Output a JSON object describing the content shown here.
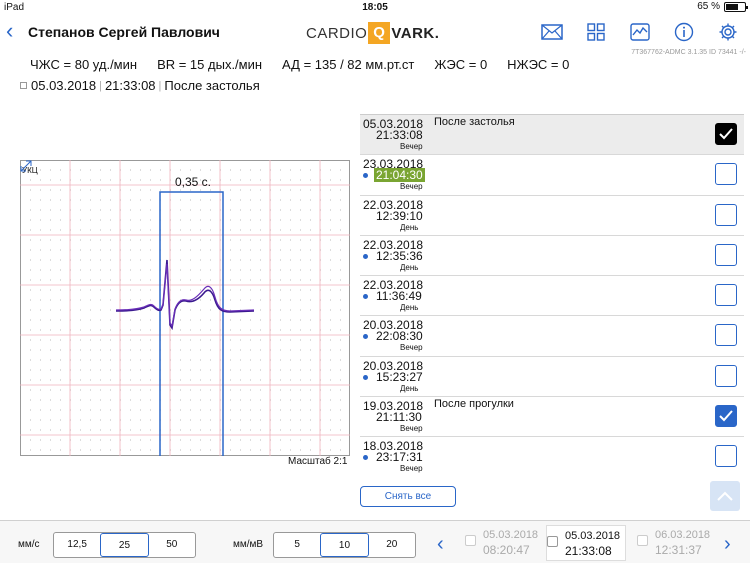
{
  "status": {
    "carrier": "iPad",
    "time": "18:05",
    "battery": "65 %",
    "battery_level": 0.65
  },
  "header": {
    "patient_name": "Степанов Сергей Павлович",
    "logo_left": "CARDIO",
    "logo_q": "Q",
    "logo_right": "VARK.",
    "version": "7T367762-ADMC 3.1.35  ID 73441  -/-"
  },
  "vitals": {
    "hr": "ЧЖС = 80 уд./мин",
    "br": "BR = 15 дых./мин",
    "bp": "АД = 135 / 82 мм.рт.ст",
    "zhes": "ЖЭС = 0",
    "nzhes": "НЖЭС = 0"
  },
  "record": {
    "date": "05.03.2018",
    "time": "21:33:08",
    "comment": "После застолья"
  },
  "ecg": {
    "lead": "УКЦ",
    "interval": "0,35 с.",
    "scale": "Масштаб 2:1",
    "interval_start_s": 0.0,
    "interval_end_s": 0.35
  },
  "records": [
    {
      "date": "05.03.2018",
      "time": "21:33:08",
      "period": "Вечер",
      "comment": "После застолья",
      "dot": false,
      "checked": "dark",
      "selected": true,
      "highlight": false
    },
    {
      "date": "23.03.2018",
      "time": "21:04:30",
      "period": "Вечер",
      "comment": "",
      "dot": true,
      "checked": "",
      "selected": false,
      "highlight": true
    },
    {
      "date": "22.03.2018",
      "time": "12:39:10",
      "period": "День",
      "comment": "",
      "dot": false,
      "checked": "",
      "selected": false,
      "highlight": false
    },
    {
      "date": "22.03.2018",
      "time": "12:35:36",
      "period": "День",
      "comment": "",
      "dot": true,
      "checked": "",
      "selected": false,
      "highlight": false
    },
    {
      "date": "22.03.2018",
      "time": "11:36:49",
      "period": "День",
      "comment": "",
      "dot": true,
      "checked": "",
      "selected": false,
      "highlight": false
    },
    {
      "date": "20.03.2018",
      "time": "22:08:30",
      "period": "Вечер",
      "comment": "",
      "dot": true,
      "checked": "",
      "selected": false,
      "highlight": false
    },
    {
      "date": "20.03.2018",
      "time": "15:23:27",
      "period": "День",
      "comment": "",
      "dot": true,
      "checked": "",
      "selected": false,
      "highlight": false
    },
    {
      "date": "19.03.2018",
      "time": "21:11:30",
      "period": "Вечер",
      "comment": "После прогулки",
      "dot": false,
      "checked": "blue",
      "selected": false,
      "highlight": false
    },
    {
      "date": "18.03.2018",
      "time": "23:17:31",
      "period": "Вечер",
      "comment": "",
      "dot": true,
      "checked": "",
      "selected": false,
      "highlight": false
    }
  ],
  "clear_all": "Снять все",
  "bottom": {
    "speed_label": "мм/с",
    "speed_options": [
      "12,5",
      "25",
      "50"
    ],
    "speed_selected": 1,
    "amp_label": "мм/мВ",
    "amp_options": [
      "5",
      "10",
      "20"
    ],
    "amp_selected": 1,
    "nav": [
      {
        "date": "05.03.2018",
        "time": "08:20:47",
        "state": "dim"
      },
      {
        "date": "05.03.2018",
        "time": "21:33:08",
        "state": "current"
      },
      {
        "date": "06.03.2018",
        "time": "12:31:37",
        "state": "dim"
      }
    ]
  },
  "colors": {
    "accent": "#2a66c8",
    "highlight": "#7aa532",
    "logo": "#f4a623",
    "ecg_trace": "#3b1a8f",
    "grid_major": "#f0b3bd",
    "grid_minor": "#bbbbbb"
  }
}
